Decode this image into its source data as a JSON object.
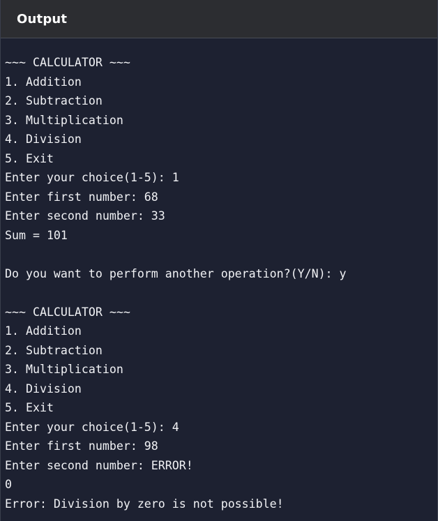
{
  "header": {
    "title": "Output"
  },
  "console": {
    "lines": [
      "~~~ CALCULATOR ~~~",
      "1. Addition",
      "2. Subtraction",
      "3. Multiplication",
      "4. Division",
      "5. Exit",
      "Enter your choice(1-5): 1",
      "Enter first number: 68",
      "Enter second number: 33",
      "Sum = 101",
      "",
      "Do you want to perform another operation?(Y/N): y",
      "",
      "~~~ CALCULATOR ~~~",
      "1. Addition",
      "2. Subtraction",
      "3. Multiplication",
      "4. Division",
      "5. Exit",
      "Enter your choice(1-5): 4",
      "Enter first number: 98",
      "Enter second number: ERROR!",
      "0",
      "Error: Division by zero is not possible!"
    ]
  }
}
